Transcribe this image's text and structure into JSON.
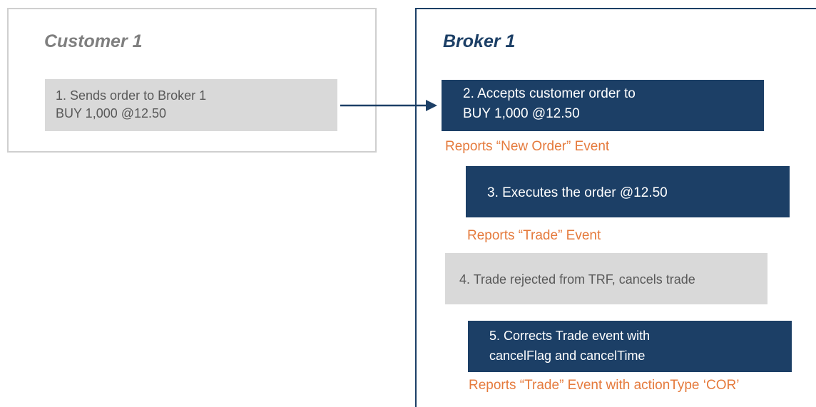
{
  "customer": {
    "title": "Customer 1",
    "step1": {
      "line1": "1. Sends order to Broker 1",
      "line2": "BUY 1,000 @12.50"
    }
  },
  "broker": {
    "title": "Broker 1",
    "step2": {
      "line1": "2. Accepts customer order to",
      "line2": "BUY 1,000 @12.50"
    },
    "report1": "Reports “New Order” Event",
    "step3": {
      "line1": "3. Executes the order @12.50"
    },
    "report2": "Reports “Trade” Event",
    "step4": {
      "line1": "4. Trade rejected from TRF, cancels trade"
    },
    "step5": {
      "line1": "5. Corrects Trade event with",
      "line2": "cancelFlag and cancelTime"
    },
    "report3": "Reports “Trade” Event with actionType ‘COR’"
  },
  "colors": {
    "navy": "#1c3f66",
    "gray_box": "#d9d9d9",
    "orange": "#e57a3c",
    "border_gray": "#cfcfcf"
  },
  "icons": {
    "connector": "arrow-right-icon"
  }
}
